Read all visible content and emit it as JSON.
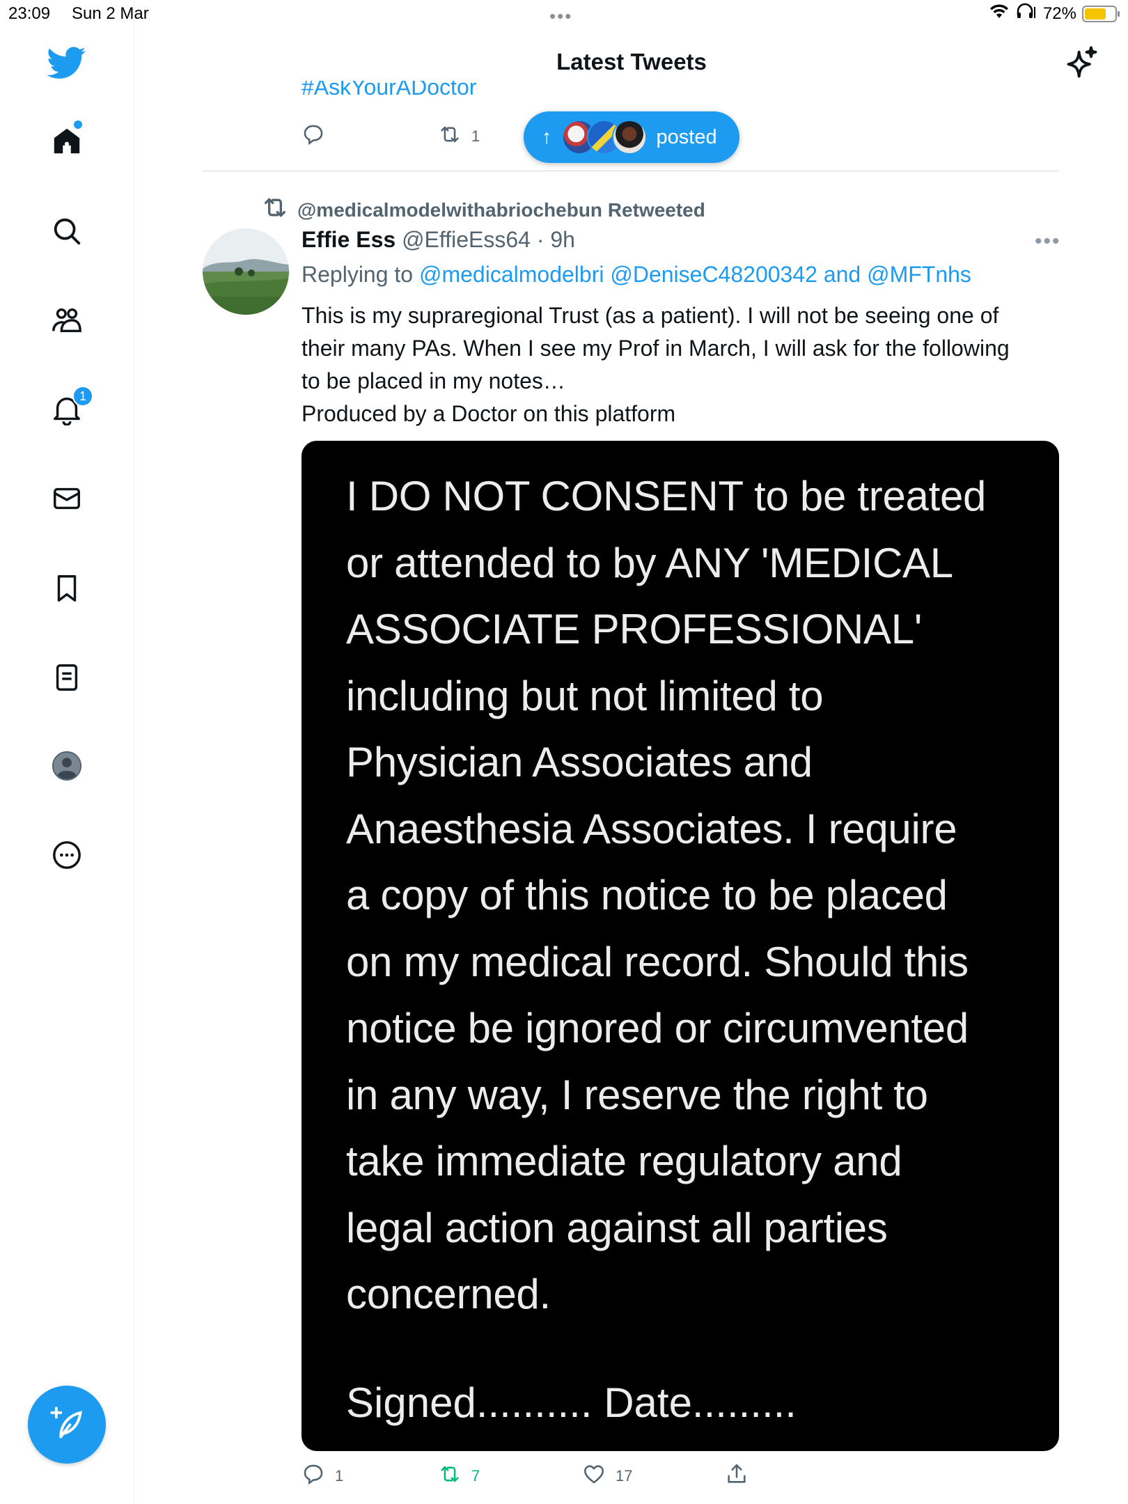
{
  "status_bar": {
    "time": "23:09",
    "date": "Sun 2 Mar",
    "dots": "•••",
    "battery_percent": "72%",
    "battery_level": 0.72,
    "battery_color": "#f5c400"
  },
  "sidebar": {
    "items": [
      {
        "icon": "twitter-bird-icon"
      },
      {
        "icon": "home-icon",
        "has_dot": true
      },
      {
        "icon": "search-icon"
      },
      {
        "icon": "communities-icon"
      },
      {
        "icon": "notifications-icon",
        "badge": "1"
      },
      {
        "icon": "messages-icon"
      },
      {
        "icon": "bookmark-icon"
      },
      {
        "icon": "lists-icon"
      },
      {
        "icon": "profile-icon"
      },
      {
        "icon": "more-icon"
      }
    ],
    "compose_icon": "compose-tweet-icon",
    "accent": "#1d9bf0"
  },
  "header": {
    "title": "Latest Tweets",
    "right_icon": "sparkle-icon"
  },
  "previous_tweet": {
    "hashtag_fragment": "#AskYourADoctor",
    "reply_count": "",
    "retweet_count": "1"
  },
  "posted_pill": {
    "label": "posted",
    "arrow": "↑"
  },
  "tweet": {
    "retweeted_by": "@medicalmodelwithabriochebun Retweeted",
    "name": "Effie Ess",
    "handle_time": " @EffieEss64 · 9h",
    "more": "•••",
    "replying_prefix": "Replying to ",
    "reply_targets": "@medicalmodelbri @DeniseC48200342",
    "reply_and": " and ",
    "reply_last": "@MFTnhs",
    "text_lines": [
      "This is my supraregional Trust (as a patient). I will not be seeing one of",
      "their many PAs. When I see my Prof in March, I will ask for the following",
      "to be placed in my notes…",
      "Produced by a Doctor on this platform"
    ],
    "image_text_lines": [
      "I DO NOT CONSENT to be treated",
      "or attended to by ANY 'MEDICAL",
      "ASSOCIATE PROFESSIONAL'",
      "including but not limited to",
      "Physician Associates and",
      "Anaesthesia Associates. I require",
      "a copy of this notice to be placed",
      "on my medical record. Should this",
      "notice be ignored or circumvented",
      "in any way, I reserve the right to",
      "take immediate regulatory and",
      "legal action against all parties",
      "concerned."
    ],
    "image_signed": "Signed..........   Date.........",
    "reply_count": "1",
    "retweet_count": "7",
    "like_count": "17",
    "retweet_color": "#00ba7c"
  }
}
